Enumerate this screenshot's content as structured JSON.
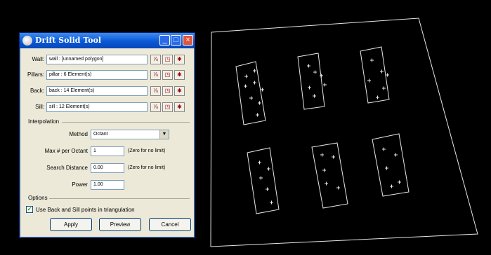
{
  "dialog": {
    "title": "Drift Solid Tool",
    "rows": [
      {
        "label": "Wall:",
        "value": "wall : [unnamed polygon]"
      },
      {
        "label": "Pillars:",
        "value": "pillar : 6 Element(s)"
      },
      {
        "label": "Back:",
        "value": "back : 14 Element(s)"
      },
      {
        "label": "Sill:",
        "value": "sill : 12 Element(s)"
      }
    ],
    "interpolation": {
      "heading": "Interpolation",
      "method_label": "Method",
      "method_value": "Octant",
      "max_label": "Max # per Octant",
      "max_value": "1",
      "max_note": "(Zero for no limit)",
      "search_label": "Search Distance",
      "search_value": "0.00",
      "search_note": "(Zero for no limit)",
      "power_label": "Power",
      "power_value": "1.00"
    },
    "options": {
      "heading": "Options",
      "checkbox_label": "Use Back and Sill points in triangulation",
      "checked": true
    },
    "buttons": {
      "apply": "Apply",
      "preview": "Preview",
      "cancel": "Cancel"
    }
  }
}
